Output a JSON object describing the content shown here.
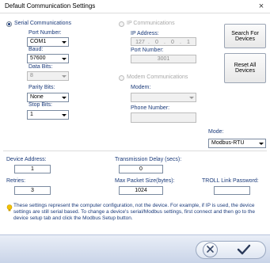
{
  "window": {
    "title": "Default Communication Settings",
    "close_glyph": "×"
  },
  "serial": {
    "radio_label": "Serial Communications",
    "port_number_label": "Port Number:",
    "port_number_value": "COM1",
    "baud_label": "Baud:",
    "baud_value": "57600",
    "data_bits_label": "Data Bits:",
    "data_bits_value": "8",
    "parity_bits_label": "Parity Bits:",
    "parity_bits_value": "None",
    "stop_bits_label": "Stop Bits:",
    "stop_bits_value": "1"
  },
  "ip": {
    "radio_label": "IP Communications",
    "ip_address_label": "IP Address:",
    "ip_octets": [
      "127",
      "0",
      "0",
      "1"
    ],
    "ip_dot": ".",
    "port_number_label": "Port Number:",
    "port_number_value": "3001"
  },
  "modem": {
    "radio_label": "Modem Communications",
    "modem_label": "Modem:",
    "modem_value": "",
    "phone_number_label": "Phone Number:",
    "phone_number_value": ""
  },
  "buttons": {
    "search_for_devices": "Search For Devices",
    "reset_all_devices": "Reset All Devices"
  },
  "mode": {
    "label": "Mode:",
    "value": "Modbus-RTU"
  },
  "device_address": {
    "label": "Device Address:",
    "value": "1"
  },
  "transmission_delay": {
    "label": "Transmission Delay (secs):",
    "value": "0"
  },
  "retries": {
    "label": "Retries:",
    "value": "3"
  },
  "max_packet_size": {
    "label": "Max Packet Size(bytes):",
    "value": "1024"
  },
  "troll_link_password": {
    "label": "TROLL Link Password:",
    "value": ""
  },
  "info_text": "These settings represent the computer configuration, not the device. For example, if IP is used, the device settings are still serial based. To change a device's serial/Modbus settings, first connect and then go to the device setup tab and click the Modbus Setup button.",
  "colors": {
    "label_blue": "#1a3a7a",
    "footer_gradient_top": "#e9eef7",
    "footer_gradient_bottom": "#c9d4e8",
    "info_icon": "#f2c200"
  },
  "icons": {
    "info": "lightbulb-icon",
    "cancel": "x-circle-icon",
    "ok": "checkmark-icon"
  }
}
